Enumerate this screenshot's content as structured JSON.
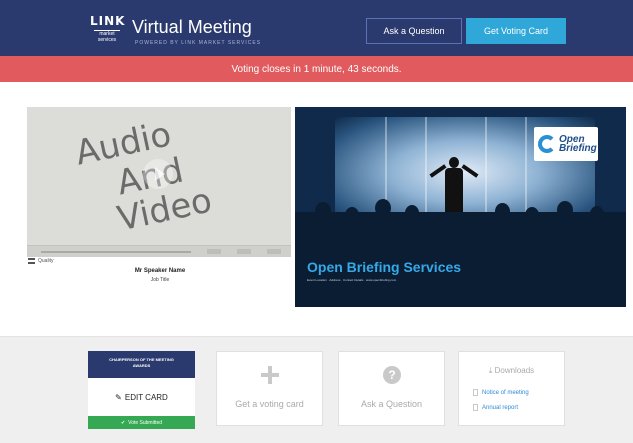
{
  "header": {
    "logo_text": "LINK",
    "logo_sub": "market services",
    "title": "Virtual Meeting",
    "subtitle": "POWERED BY LINK MARKET SERVICES",
    "ask_button": "Ask a Question",
    "voting_button": "Get Voting Card"
  },
  "banner": {
    "text": "Voting closes in 1 minute, 43 seconds."
  },
  "player": {
    "overlay_line1": "Audio",
    "overlay_line2": "And",
    "overlay_line3": "Video",
    "quality_label": "Quality",
    "speaker_name": "Mr Speaker Name",
    "speaker_role": "Job Title"
  },
  "slide": {
    "logo_text_line1": "Open",
    "logo_text_line2": "Briefing",
    "title": "Open Briefing Services",
    "sub_text": "Event Location · Address · Contact Details · www.openbriefing.com"
  },
  "cards": {
    "chair_title": "CHAIRPERSON OF THE MEETING",
    "chair_sub": "AWARDS",
    "edit_label": "EDIT CARD",
    "submitted_label": "Vote Submitted",
    "get_voting_label": "Get a voting card",
    "ask_question_label": "Ask a Question",
    "downloads_title": "Downloads",
    "downloads_items": [
      "Notice of meeting",
      "Annual report"
    ]
  },
  "colors": {
    "header_bg": "#2a3a6e",
    "banner_bg": "#e05a5e",
    "accent_blue": "#2fa7d9",
    "success_green": "#35a853"
  }
}
